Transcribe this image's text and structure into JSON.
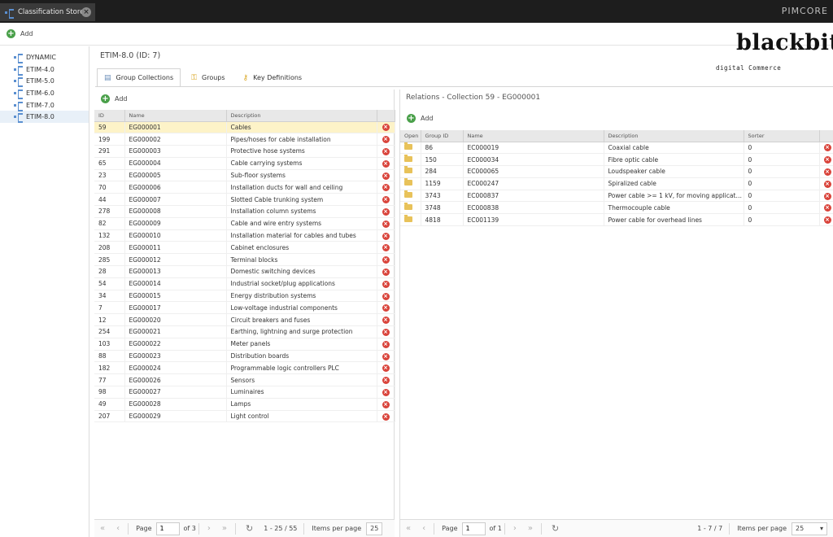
{
  "app": {
    "tab_title": "Classification Store",
    "brand": "PIMCORE"
  },
  "toolbar": {
    "add_label": "Add"
  },
  "tree": {
    "items": [
      {
        "label": "DYNAMIC"
      },
      {
        "label": "ETIM-4.0"
      },
      {
        "label": "ETIM-5.0"
      },
      {
        "label": "ETIM-6.0"
      },
      {
        "label": "ETIM-7.0"
      },
      {
        "label": "ETIM-8.0",
        "selected": true
      }
    ]
  },
  "content": {
    "title": "ETIM-8.0 (ID: 7)",
    "logo": "blackbit",
    "logo_sub": "digital Commerce",
    "tabs": [
      {
        "label": "Group Collections",
        "icon": "table-icon",
        "active": true
      },
      {
        "label": "Groups",
        "icon": "groups-icon"
      },
      {
        "label": "Key Definitions",
        "icon": "key-icon"
      }
    ]
  },
  "collections": {
    "add_label": "Add",
    "columns": [
      "ID",
      "Name",
      "Description"
    ],
    "rows": [
      [
        "59",
        "EG000001",
        "Cables"
      ],
      [
        "199",
        "EG000002",
        "Pipes/hoses for cable installation"
      ],
      [
        "291",
        "EG000003",
        "Protective hose systems"
      ],
      [
        "65",
        "EG000004",
        "Cable carrying systems"
      ],
      [
        "23",
        "EG000005",
        "Sub-floor systems"
      ],
      [
        "70",
        "EG000006",
        "Installation ducts for wall and ceiling"
      ],
      [
        "44",
        "EG000007",
        "Slotted Cable trunking system"
      ],
      [
        "278",
        "EG000008",
        "Installation column systems"
      ],
      [
        "82",
        "EG000009",
        "Cable and wire entry systems"
      ],
      [
        "132",
        "EG000010",
        "Installation material for cables and tubes"
      ],
      [
        "208",
        "EG000011",
        "Cabinet enclosures"
      ],
      [
        "285",
        "EG000012",
        "Terminal blocks"
      ],
      [
        "28",
        "EG000013",
        "Domestic switching devices"
      ],
      [
        "54",
        "EG000014",
        "Industrial socket/plug applications"
      ],
      [
        "34",
        "EG000015",
        "Energy distribution systems"
      ],
      [
        "7",
        "EG000017",
        "Low-voltage industrial components"
      ],
      [
        "12",
        "EG000020",
        "Circuit breakers and fuses"
      ],
      [
        "254",
        "EG000021",
        "Earthing, lightning and surge protection"
      ],
      [
        "103",
        "EG000022",
        "Meter panels"
      ],
      [
        "88",
        "EG000023",
        "Distribution boards"
      ],
      [
        "182",
        "EG000024",
        "Programmable logic controllers PLC"
      ],
      [
        "77",
        "EG000026",
        "Sensors"
      ],
      [
        "98",
        "EG000027",
        "Luminaires"
      ],
      [
        "49",
        "EG000028",
        "Lamps"
      ],
      [
        "207",
        "EG000029",
        "Light control"
      ]
    ],
    "selected_index": 0,
    "pager": {
      "page_label": "Page",
      "page": "1",
      "of": "of 3",
      "range": "1 - 25 / 55",
      "per_page_label": "Items per page",
      "per_page": "25"
    }
  },
  "relations": {
    "title": "Relations - Collection 59 - EG000001",
    "add_label": "Add",
    "columns": [
      "Open",
      "Group ID",
      "Name",
      "Description",
      "Sorter"
    ],
    "rows": [
      [
        "86",
        "EC000019",
        "Coaxial cable",
        "0"
      ],
      [
        "150",
        "EC000034",
        "Fibre optic cable",
        "0"
      ],
      [
        "284",
        "EC000065",
        "Loudspeaker cable",
        "0"
      ],
      [
        "1159",
        "EC000247",
        "Spiralized cable",
        "0"
      ],
      [
        "3743",
        "EC000837",
        "Power cable >= 1 kV, for moving applicati...",
        "0"
      ],
      [
        "3748",
        "EC000838",
        "Thermocouple cable",
        "0"
      ],
      [
        "4818",
        "EC001139",
        "Power cable for overhead lines",
        "0"
      ]
    ],
    "pager": {
      "page_label": "Page",
      "page": "1",
      "of": "of 1",
      "range": "1 - 7 / 7",
      "per_page_label": "Items per page",
      "per_page": "25"
    }
  },
  "colors": {
    "accent_add": "#4aa04a",
    "delete": "#d9433a",
    "selected_row": "#fdf3c8"
  }
}
